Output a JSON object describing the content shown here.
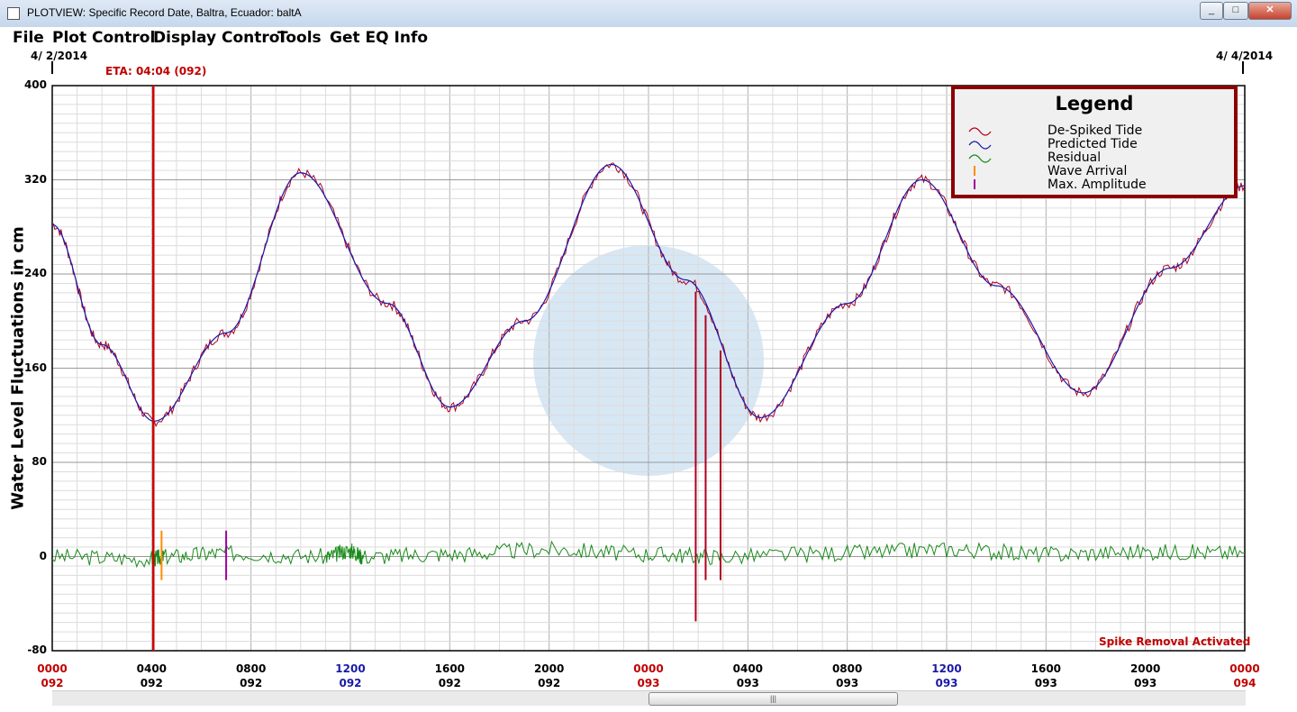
{
  "window": {
    "title": "PLOTVIEW: Specific Record Date, Baltra, Ecuador: baltA",
    "minimize": "_",
    "maximize": "□",
    "close": "✕"
  },
  "menu": [
    "File",
    "Plot Control",
    "Display Control",
    "Tools",
    "Get EQ Info"
  ],
  "top_dates": {
    "left": "4/ 2/2014",
    "right": "4/ 4/2014"
  },
  "eta_label": "ETA: 04:04 (092)",
  "status": "Spike Removal Activated",
  "legend": {
    "title": "Legend",
    "items": [
      {
        "label": "De-Spiked Tide",
        "color": "#b00020",
        "icon": "wave-icon"
      },
      {
        "label": "Predicted Tide",
        "color": "#1a1aa8",
        "icon": "wave-icon"
      },
      {
        "label": "Residual",
        "color": "#1a8a1a",
        "icon": "wave-icon"
      },
      {
        "label": "Wave Arrival",
        "color": "#ff8c00",
        "icon": "tick-icon"
      },
      {
        "label": "Max. Amplitude",
        "color": "#a000a0",
        "icon": "tick-icon"
      }
    ]
  },
  "chart_data": {
    "type": "line",
    "title": "",
    "xlabel": "",
    "ylabel": "Water Level Fluctuations in cm",
    "ylim": [
      -80,
      400
    ],
    "yticks": [
      -80,
      0,
      80,
      160,
      240,
      320,
      400
    ],
    "x_unit": "hours since 0000 day 092",
    "xlim": [
      0,
      48
    ],
    "xticks": [
      {
        "time": "0000",
        "day": "092",
        "color": "#c00000"
      },
      {
        "time": "0400",
        "day": "092",
        "color": "#000000"
      },
      {
        "time": "0800",
        "day": "092",
        "color": "#000000"
      },
      {
        "time": "1200",
        "day": "092",
        "color": "#1a1aa8"
      },
      {
        "time": "1600",
        "day": "092",
        "color": "#000000"
      },
      {
        "time": "2000",
        "day": "092",
        "color": "#000000"
      },
      {
        "time": "0000",
        "day": "093",
        "color": "#c00000"
      },
      {
        "time": "0400",
        "day": "093",
        "color": "#000000"
      },
      {
        "time": "0800",
        "day": "093",
        "color": "#000000"
      },
      {
        "time": "1200",
        "day": "093",
        "color": "#1a1aa8"
      },
      {
        "time": "1600",
        "day": "093",
        "color": "#000000"
      },
      {
        "time": "2000",
        "day": "093",
        "color": "#000000"
      },
      {
        "time": "0000",
        "day": "094",
        "color": "#c00000"
      }
    ],
    "grid": true,
    "legend_position": "top-right",
    "series": [
      {
        "name": "Predicted Tide",
        "color": "#1a1aa8",
        "x": [
          0,
          2,
          4.1,
          7,
          10,
          13.5,
          16,
          19,
          22.5,
          25.5,
          28.5,
          32,
          35,
          38,
          41.5,
          45,
          48
        ],
        "y": [
          282,
          180,
          115,
          190,
          326,
          215,
          127,
          200,
          333,
          235,
          118,
          215,
          320,
          230,
          139,
          245,
          315
        ]
      },
      {
        "name": "De-Spiked Tide",
        "color": "#b00020",
        "x": [
          0,
          2,
          4.1,
          7,
          10,
          13.5,
          16,
          19,
          22.5,
          25.5,
          28.5,
          32,
          35,
          38,
          41.5,
          45,
          48
        ],
        "y": [
          282,
          180,
          115,
          190,
          326,
          215,
          127,
          200,
          333,
          235,
          118,
          215,
          320,
          230,
          139,
          245,
          315
        ]
      },
      {
        "name": "Residual",
        "color": "#1a8a1a",
        "x": [
          0,
          4,
          4.5,
          7,
          11,
          12,
          12.5,
          16,
          20,
          24,
          27,
          32,
          36,
          40,
          44,
          48
        ],
        "y": [
          0,
          -2,
          0,
          3,
          0,
          5,
          0,
          2,
          6,
          2,
          0,
          3,
          6,
          2,
          4,
          3
        ]
      }
    ],
    "spikes": [
      {
        "x": 25.9,
        "y_top": 225,
        "y_bottom": -55
      },
      {
        "x": 26.3,
        "y_top": 205,
        "y_bottom": -20
      },
      {
        "x": 26.9,
        "y_top": 175,
        "y_bottom": -20
      }
    ],
    "markers": [
      {
        "name": "ETA",
        "x": 4.07,
        "color": "#d00000"
      },
      {
        "name": "Wave Arrival",
        "x": 4.4,
        "y": [
          -20,
          22
        ],
        "color": "#ff8c00"
      },
      {
        "name": "Max. Amplitude",
        "x": 7.0,
        "y": [
          -20,
          22
        ],
        "color": "#a000a0"
      }
    ]
  }
}
